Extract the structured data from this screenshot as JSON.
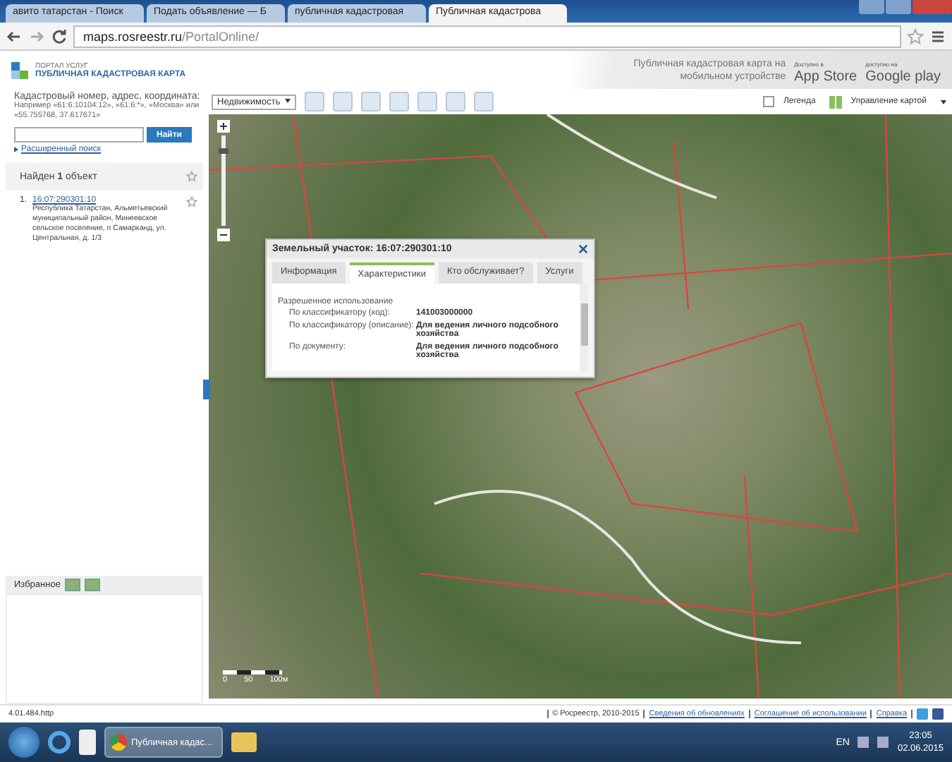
{
  "browser": {
    "tabs": [
      {
        "title": "авито татарстан - Поиск",
        "selected": false
      },
      {
        "title": "Подать объявление — Б",
        "selected": false
      },
      {
        "title": "публичная кадастровая",
        "selected": false
      },
      {
        "title": "Публичная кадастрова",
        "selected": true
      }
    ],
    "url_host": "maps.rosreestr.ru",
    "url_path": "/PortalOnline/"
  },
  "header": {
    "portal_label": "ПОРТАЛ УСЛУГ",
    "title": "ПУБЛИЧНАЯ КАДАСТРОВАЯ КАРТА",
    "mobile_promo": "Публичная кадастровая карта на мобильном устройстве",
    "app_store": {
      "small": "Доступно в",
      "big": "App Store"
    },
    "google_play": {
      "small": "доступно на",
      "big": "Google play"
    }
  },
  "search": {
    "label": "Кадастровый номер, адрес, координата:",
    "hint": "Например «61:6:10104:12», «61:6:*», «Москва» или «55.755768, 37.617671»",
    "button": "Найти",
    "advanced": "Расширенный поиск"
  },
  "results": {
    "heading": "Найден **1** объект",
    "items": [
      {
        "number": "1.",
        "id": "16:07:290301:10",
        "address": "Республика Татарстан, Альметьевский муниципальный район, Минеевское сельское поселение, п Самарканд, ул. Центральная, д. 1/3"
      }
    ]
  },
  "favorites": {
    "label": "Избранное"
  },
  "toolbar": {
    "layer": "Недвижимость",
    "legend": {
      "label": "Легенда",
      "checked": false
    },
    "map_control": "Управление картой"
  },
  "popup": {
    "title": "Земельный участок: 16:07:290301:10",
    "tabs": [
      {
        "label": "Информация",
        "selected": false
      },
      {
        "label": "Характеристики",
        "selected": true
      },
      {
        "label": "Кто обслуживает?",
        "selected": false
      },
      {
        "label": "Услуги",
        "selected": false
      }
    ],
    "section": "Разрешенное использование",
    "rows": [
      {
        "label": "По классификатору (код):",
        "value": "141003000000"
      },
      {
        "label": "По классификатору (описание):",
        "value": "Для ведения личного подсобного хозяйства"
      },
      {
        "label": "По документу:",
        "value": "Для ведения личного подсобного хозяйства"
      }
    ]
  },
  "scale": [
    "0",
    "50",
    "100м"
  ],
  "zoom": {
    "level": 0.8
  },
  "footer": {
    "version": "4.01.484.http",
    "copyright": "© Росреестр, 2010-2015",
    "links": [
      "Сведения об обновлениях",
      "Соглашение об использовании",
      "Справка"
    ]
  },
  "taskbar": {
    "task": "Публичная кадас...",
    "language": "EN",
    "time": "23:05",
    "date": "02.06.2015"
  }
}
